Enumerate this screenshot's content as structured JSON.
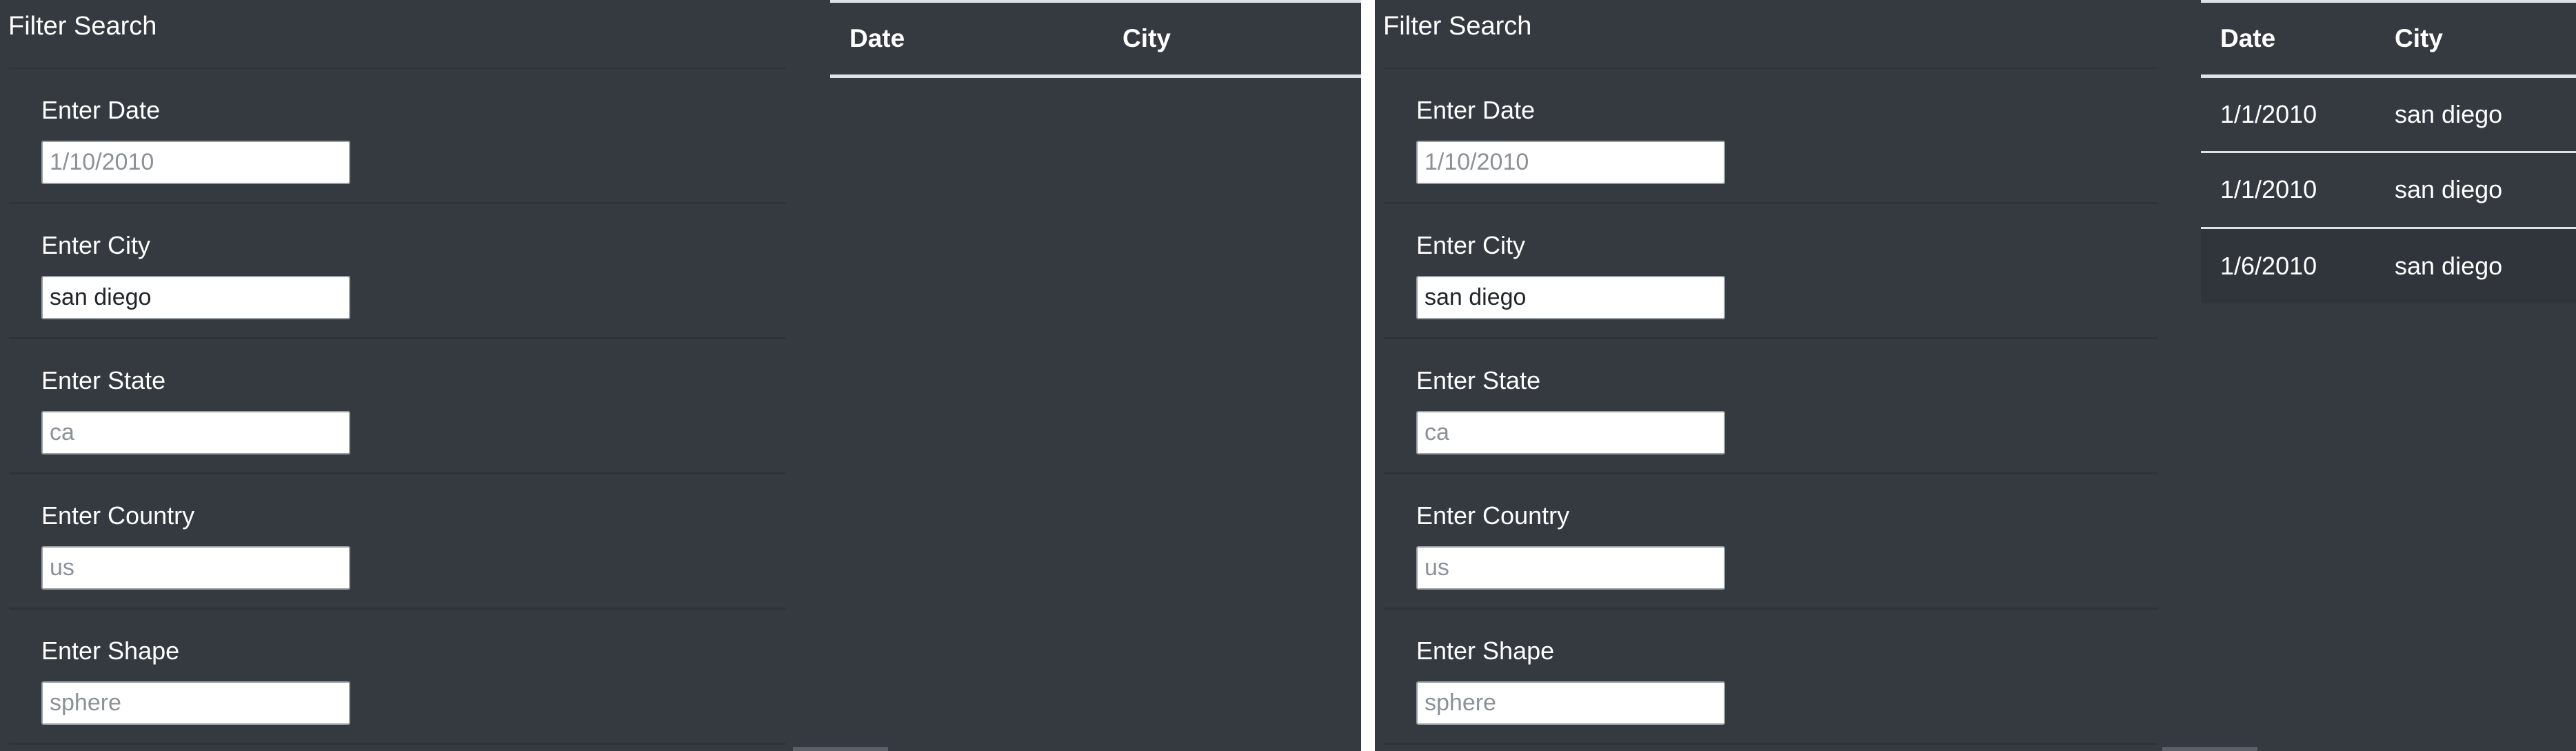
{
  "panels": [
    {
      "filter": {
        "title": "Filter Search",
        "fields": [
          {
            "label": "Enter Date",
            "value": "",
            "placeholder": "1/10/2010"
          },
          {
            "label": "Enter City",
            "value": "san diego",
            "placeholder": ""
          },
          {
            "label": "Enter State",
            "value": "",
            "placeholder": "ca"
          },
          {
            "label": "Enter Country",
            "value": "",
            "placeholder": "us"
          },
          {
            "label": "Enter Shape",
            "value": "",
            "placeholder": "sphere"
          }
        ]
      },
      "table": {
        "headers": [
          "Date",
          "City"
        ],
        "rows": []
      }
    },
    {
      "filter": {
        "title": "Filter Search",
        "fields": [
          {
            "label": "Enter Date",
            "value": "",
            "placeholder": "1/10/2010"
          },
          {
            "label": "Enter City",
            "value": "san diego",
            "placeholder": ""
          },
          {
            "label": "Enter State",
            "value": "",
            "placeholder": "ca"
          },
          {
            "label": "Enter Country",
            "value": "",
            "placeholder": "us"
          },
          {
            "label": "Enter Shape",
            "value": "",
            "placeholder": "sphere"
          }
        ]
      },
      "table": {
        "headers": [
          "Date",
          "City"
        ],
        "rows": [
          [
            "1/1/2010",
            "san diego"
          ],
          [
            "1/1/2010",
            "san diego"
          ],
          [
            "1/6/2010",
            "san diego"
          ]
        ]
      }
    }
  ]
}
